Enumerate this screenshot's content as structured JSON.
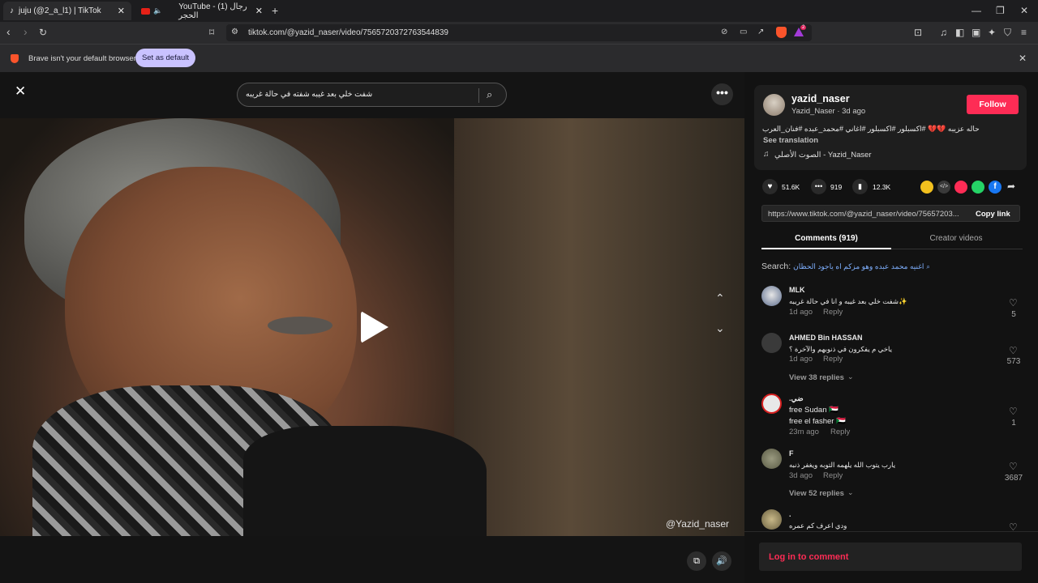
{
  "browser": {
    "tabs": [
      {
        "title": "juju (@2_a_l1) | TikTok",
        "active": true
      },
      {
        "title": "YouTube - (1) رجال الحجر",
        "active": false
      }
    ],
    "url": "tiktok.com/@yazid_naser/video/7565720372763544839",
    "infobar": {
      "message": "Brave isn't your default browser",
      "button": "Set as default"
    },
    "brave_badge": "2"
  },
  "viewer": {
    "search_value": "شفت خلي بعد غيبه شفته في حالة غريبه",
    "watermark": "@Yazid_naser"
  },
  "post": {
    "username": "yazid_naser",
    "subline": "Yazid_Naser · 3d ago",
    "follow_label": "Follow",
    "caption": "حاله عزيبه 💔💔 #اكسبلور #اكسبلور #اغاني #محمد_عبده #فنان_العرب",
    "see_translation": "See translation",
    "music": "الصوت الأصلي - Yazid_Naser",
    "likes": "51.6K",
    "comments": "919",
    "saves": "12.3K",
    "link": "https://www.tiktok.com/@yazid_naser/video/75657203...",
    "copy_link": "Copy link"
  },
  "tabs": {
    "comments": "Comments (919)",
    "creator": "Creator videos"
  },
  "search_suggest": {
    "label": "Search:",
    "query": "اغنيه محمد عبده وهو مزكم اه ياجود الحظان"
  },
  "comments": [
    {
      "name": "MLK",
      "text": "شفت خلي بعد غيبه و انا في حالة غريبه✨",
      "time": "1d ago",
      "reply": "Reply",
      "likes": "5",
      "avatar": "#5a6b8c"
    },
    {
      "name": "AHMED Bin HASSAN",
      "text": "ياخي م يفكرون في ذنوبهم والآخرة ؟",
      "time": "1d ago",
      "reply": "Reply",
      "likes": "573",
      "replies": "View 38 replies",
      "avatar": "#3a3a3a"
    },
    {
      "name": ".ضي",
      "text": "free Sudan 🇸🇩",
      "text2": "free el fasher 🇸🇩",
      "time": "23m ago",
      "reply": "Reply",
      "likes": "1",
      "avatar": "#e8e8e8"
    },
    {
      "name": "F",
      "text": "يارب يتوب الله يلهمه التوبه ويغفر ذنبه",
      "time": "3d ago",
      "reply": "Reply",
      "likes": "3687",
      "replies": "View 52 replies",
      "avatar": "#6a6b55"
    },
    {
      "name": ".",
      "text": "ودي اعرف كم عمره",
      "avatar": "#8a8060"
    }
  ],
  "footer": {
    "login": "Log in to comment"
  },
  "colors": {
    "accent": "#fe2c55",
    "link": "#7fb0ff",
    "set_default": "#c9c2ff"
  }
}
